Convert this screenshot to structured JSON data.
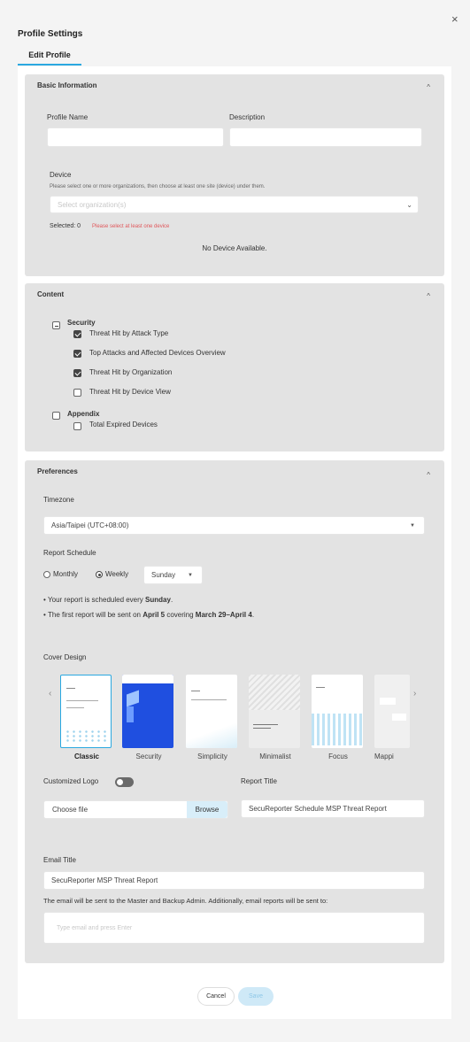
{
  "window": {
    "title": "Profile Settings",
    "close": "×",
    "tab": "Edit Profile"
  },
  "basic": {
    "header": "Basic Information",
    "profile_name_label": "Profile Name",
    "profile_name_value": "",
    "description_label": "Description",
    "description_value": "",
    "device_label": "Device",
    "device_hint": "Please select one or more organizations, then choose at least one site (device) under them.",
    "org_placeholder": "Select organization(s)",
    "selected": "Selected: 0",
    "error": "Please select at least one device",
    "empty": "No Device Available."
  },
  "content": {
    "header": "Content",
    "security": "Security",
    "items": [
      {
        "label": "Threat Hit by Attack Type",
        "checked": true
      },
      {
        "label": "Top Attacks and Affected Devices Overview",
        "checked": true
      },
      {
        "label": "Threat Hit by Organization",
        "checked": true
      },
      {
        "label": "Threat Hit by Device View",
        "checked": false
      }
    ],
    "appendix": "Appendix",
    "appendix_items": [
      {
        "label": "Total Expired Devices",
        "checked": false
      }
    ]
  },
  "prefs": {
    "header": "Preferences",
    "timezone_label": "Timezone",
    "timezone_value": "Asia/Taipei (UTC+08:00)",
    "schedule_label": "Report Schedule",
    "monthly": "Monthly",
    "weekly": "Weekly",
    "day": "Sunday",
    "note1_pre": "Your report is scheduled every ",
    "note1_day": "Sunday",
    "note1_post": ".",
    "note2_pre": "The first report will be sent on ",
    "note2_date": "April 5",
    "note2_mid": " covering ",
    "note2_range": "March 29–April 4",
    "note2_post": ".",
    "cover_label": "Cover Design",
    "covers": [
      "Classic",
      "Security",
      "Simplicity",
      "Minimalist",
      "Focus",
      "Mappi"
    ],
    "logo_label": "Customized Logo",
    "choose_file": "Choose file",
    "browse": "Browse",
    "report_title_label": "Report Title",
    "report_title_value": "SecuReporter Schedule MSP Threat Report",
    "email_title_label": "Email Title",
    "email_title_value": "SecuReporter MSP Threat Report",
    "email_note": "The email will be sent to the Master and Backup Admin. Additionally, email reports will be sent to:",
    "email_placeholder": "Type email and press Enter"
  },
  "footer": {
    "cancel": "Cancel",
    "save": "Save"
  },
  "colors": {
    "accent": "#2aa8e0",
    "error": "#e0565a",
    "save_bg": "#cfe9f7",
    "save_text": "#8fc8e8"
  }
}
